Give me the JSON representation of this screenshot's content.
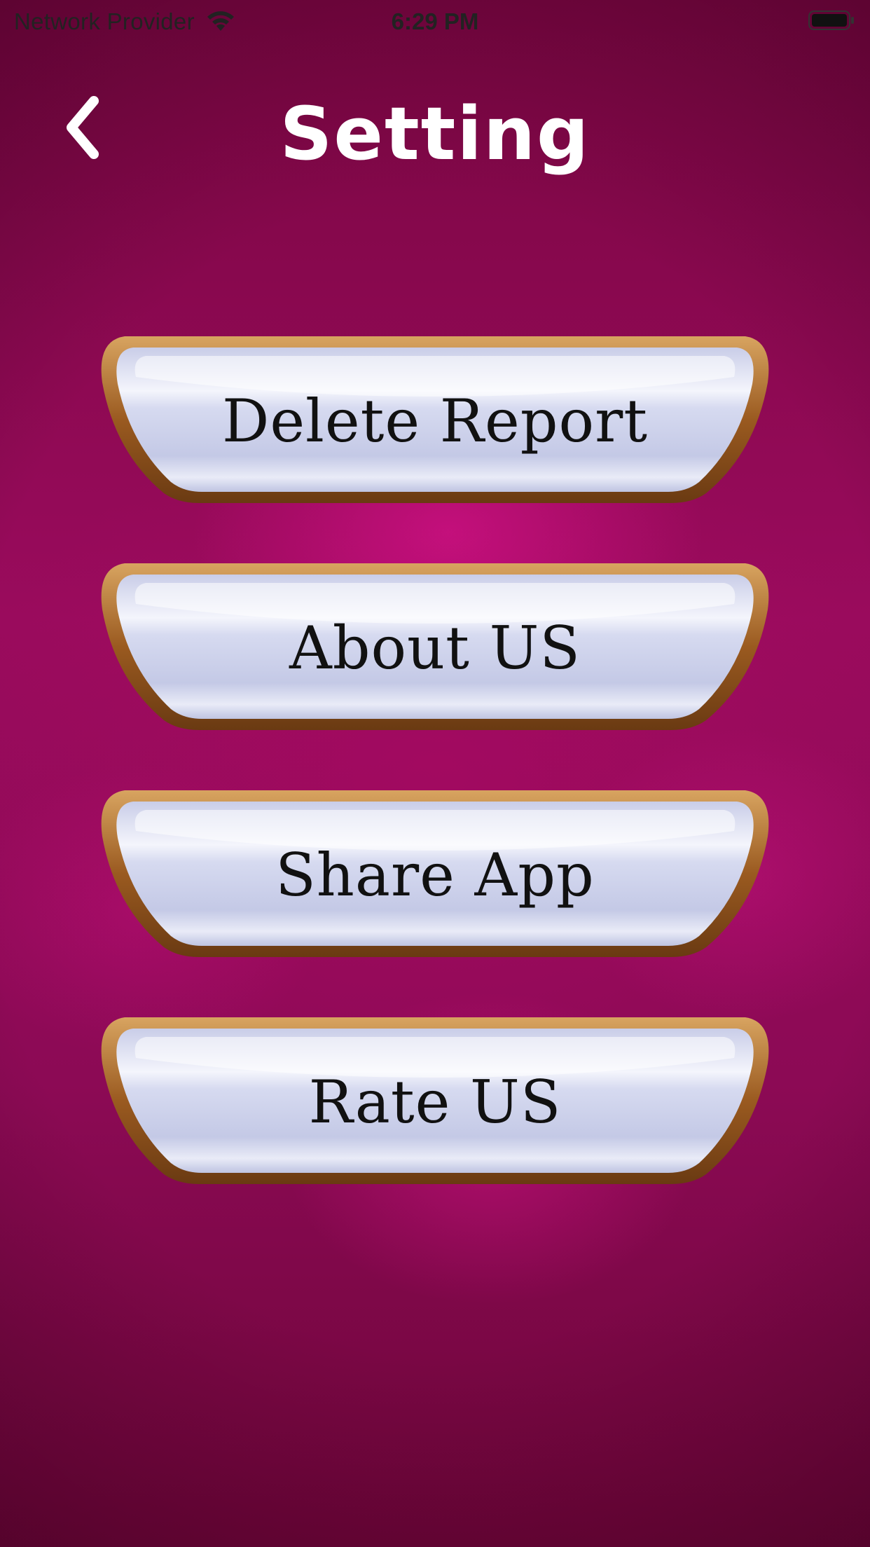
{
  "status_bar": {
    "carrier": "Network Provider",
    "time": "6:29 PM",
    "wifi_icon": "wifi-icon",
    "battery_icon": "battery-icon"
  },
  "header": {
    "title": "Setting",
    "back_icon": "chevron-left-icon"
  },
  "menu": {
    "items": [
      {
        "label": "Delete Report"
      },
      {
        "label": "About US"
      },
      {
        "label": "Share App"
      },
      {
        "label": "Rate US"
      }
    ]
  },
  "colors": {
    "background": "#8a0a4f",
    "button_frame": "#a9682a",
    "button_face": "#d8dcf0",
    "title_text": "#ffffff",
    "button_text": "#111111"
  }
}
